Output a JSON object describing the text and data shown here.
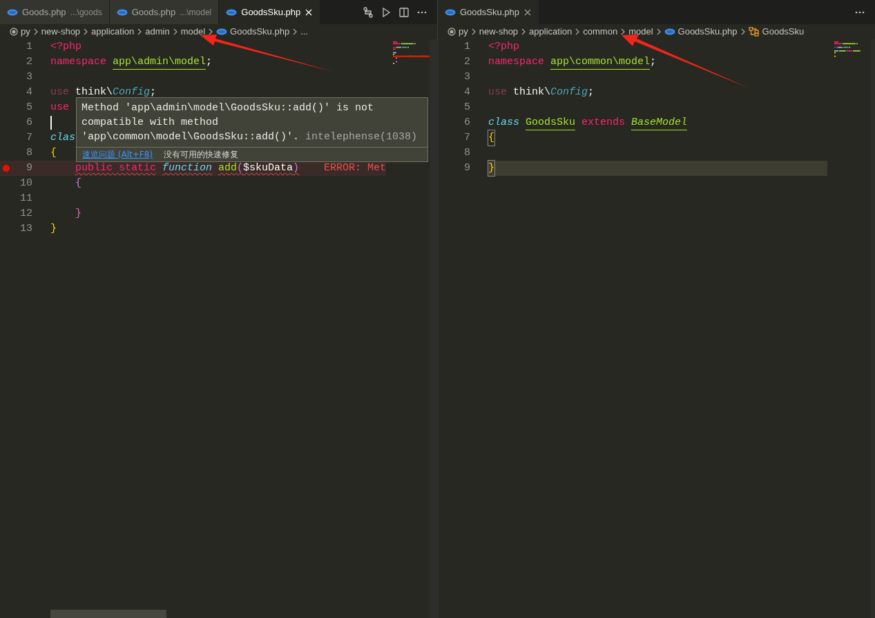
{
  "panes": [
    {
      "focused": true,
      "tabs": [
        {
          "label": "Goods.php",
          "description": "...\\goods",
          "selected": false
        },
        {
          "label": "Goods.php",
          "description": "...\\model",
          "selected": false
        },
        {
          "label": "GoodsSku.php",
          "selected": true
        }
      ],
      "tab_actions": [
        {
          "kind": "compare"
        },
        {
          "kind": "run"
        },
        {
          "kind": "split"
        },
        {
          "kind": "more"
        }
      ],
      "breadcrumb": [
        {
          "kind": "folder-root",
          "label": "py"
        },
        {
          "kind": "folder",
          "label": "new-shop"
        },
        {
          "kind": "folder",
          "label": "application"
        },
        {
          "kind": "folder",
          "label": "admin"
        },
        {
          "kind": "folder",
          "label": "model"
        },
        {
          "kind": "file",
          "label": "GoodsSku.php"
        },
        {
          "kind": "folder",
          "label": "..."
        }
      ],
      "lines": [
        {
          "number": "1",
          "tokens": [
            {
              "kind": "tag",
              "text": "<?php"
            }
          ]
        },
        {
          "number": "2",
          "tokens": [
            {
              "kind": "keyword",
              "text": "namespace"
            },
            {
              "kind": "name",
              "text": "app\\admin\\model",
              "gap": true,
              "underline": true
            },
            {
              "kind": "plain",
              "text": ";"
            }
          ]
        },
        {
          "number": "3"
        },
        {
          "number": "4",
          "tokens": [
            {
              "kind": "faded",
              "text": "use"
            },
            {
              "kind": "plain",
              "text": "think\\",
              "gap": true
            },
            {
              "kind": "type",
              "text": "Config"
            },
            {
              "kind": "plain",
              "text": ";"
            }
          ]
        },
        {
          "number": "5",
          "tokens": [
            {
              "kind": "keyword",
              "text": "use"
            }
          ]
        },
        {
          "number": "6",
          "cursor": true
        },
        {
          "number": "7",
          "tokens": [
            {
              "kind": "storage",
              "text": "clas"
            }
          ]
        },
        {
          "number": "8",
          "tokens": [
            {
              "kind": "brace",
              "text": "{"
            }
          ],
          "children": [
            {
              "number": "9",
              "breakpoint": true,
              "error": true,
              "tokens": [
                {
                  "kind": "keyword",
                  "text": "public static",
                  "squiggle": true
                },
                {
                  "kind": "storage",
                  "text": "function",
                  "gap": true,
                  "squiggle": true
                },
                {
                  "kind": "name",
                  "text": "add",
                  "gap": true,
                  "squiggle": true
                },
                {
                  "kind": "paren",
                  "text": "(",
                  "squiggle": true
                },
                {
                  "kind": "plain",
                  "text": "$skuData",
                  "squiggle": true
                },
                {
                  "kind": "paren",
                  "text": ")",
                  "squiggle": true
                },
                {
                  "kind": "error",
                  "text": "ERROR: Met"
                }
              ]
            },
            {
              "number": "10",
              "tokens": [
                {
                  "kind": "paren",
                  "text": "{"
                }
              ]
            },
            {
              "number": "11"
            },
            {
              "number": "12",
              "tokens": [
                {
                  "kind": "paren",
                  "text": "}"
                }
              ]
            }
          ]
        },
        {
          "number": "13",
          "tokens": [
            {
              "kind": "brace",
              "text": "}"
            }
          ]
        }
      ],
      "hover": {
        "message": "Method 'app\\admin\\model\\GoodsSku::add()' is not compatible with method 'app\\common\\model\\GoodsSku::add()'.",
        "source": "intelephense(1038)",
        "peek_link": "速览问题 (Alt+F8)",
        "no_fix": "没有可用的快速修复"
      }
    },
    {
      "focused": false,
      "tabs": [
        {
          "label": "GoodsSku.php",
          "selected": true
        }
      ],
      "tab_actions": [
        {
          "kind": "more"
        }
      ],
      "breadcrumb": [
        {
          "kind": "folder-root",
          "label": "py"
        },
        {
          "kind": "folder",
          "label": "new-shop"
        },
        {
          "kind": "folder",
          "label": "application"
        },
        {
          "kind": "folder",
          "label": "common"
        },
        {
          "kind": "folder",
          "label": "model"
        },
        {
          "kind": "file",
          "label": "GoodsSku.php"
        },
        {
          "kind": "class",
          "label": "GoodsSku"
        }
      ],
      "lines": [
        {
          "number": "1",
          "tokens": [
            {
              "kind": "tag",
              "text": "<?php"
            }
          ]
        },
        {
          "number": "2",
          "tokens": [
            {
              "kind": "keyword",
              "text": "namespace"
            },
            {
              "kind": "name",
              "text": "app\\common\\model",
              "gap": true,
              "underline": true
            },
            {
              "kind": "plain",
              "text": ";"
            }
          ]
        },
        {
          "number": "3"
        },
        {
          "number": "4",
          "tokens": [
            {
              "kind": "faded",
              "text": "use"
            },
            {
              "kind": "plain",
              "text": "think\\",
              "gap": true
            },
            {
              "kind": "type",
              "text": "Config"
            },
            {
              "kind": "plain",
              "text": ";"
            }
          ]
        },
        {
          "number": "5"
        },
        {
          "number": "6",
          "tokens": [
            {
              "kind": "storage",
              "text": "class"
            },
            {
              "kind": "name",
              "text": "GoodsSku",
              "gap": true,
              "underline": true
            },
            {
              "kind": "keyword",
              "text": "extends",
              "gap": true
            },
            {
              "kind": "italicname",
              "text": "BaseModel",
              "gap": true,
              "underline": true
            }
          ]
        },
        {
          "number": "7",
          "tokens": [
            {
              "kind": "brace",
              "text": "{",
              "matched": true
            }
          ]
        },
        {
          "number": "8"
        },
        {
          "number": "9",
          "current": true,
          "tokens": [
            {
              "kind": "brace",
              "text": "}",
              "matched": true
            }
          ]
        }
      ]
    }
  ]
}
